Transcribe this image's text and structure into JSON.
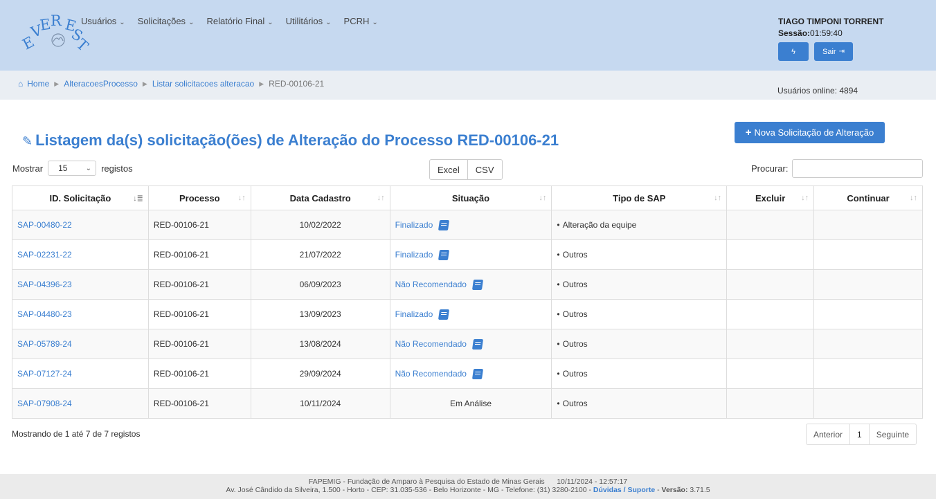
{
  "logo_text": "EVEREST",
  "nav": [
    {
      "label": "Usuários"
    },
    {
      "label": "Solicitações"
    },
    {
      "label": "Relatório Final"
    },
    {
      "label": "Utilitários"
    },
    {
      "label": "PCRH"
    }
  ],
  "user": {
    "name": "TIAGO TIMPONI TORRENT",
    "session_label": "Sessão:",
    "session_time": "01:59:40",
    "bolt_icon": "bolt-icon",
    "logout_label": "Sair",
    "logout_icon": "sign-out-icon"
  },
  "breadcrumb": {
    "home": "Home",
    "items": [
      "AlteracoesProcesso",
      "Listar solicitacoes alteracao"
    ],
    "current": "RED-00106-21"
  },
  "online_users": "Usuários online: 4894",
  "page": {
    "title": "Listagem da(s) solicitação(ões) de Alteração do Processo RED-00106-21",
    "new_button": "Nova Solicitação de Alteração"
  },
  "controls": {
    "show_label": "Mostrar",
    "show_value": "15",
    "show_suffix": "registos",
    "excel": "Excel",
    "csv": "CSV",
    "search_label": "Procurar:",
    "search_value": ""
  },
  "table": {
    "headers": [
      "ID. Solicitação",
      "Processo",
      "Data Cadastro",
      "Situação",
      "Tipo de SAP",
      "Excluir",
      "Continuar"
    ],
    "rows": [
      {
        "id": "SAP-00480-22",
        "processo": "RED-00106-21",
        "data": "10/02/2022",
        "situacao": "Finalizado",
        "tipo": "Alteração da equipe"
      },
      {
        "id": "SAP-02231-22",
        "processo": "RED-00106-21",
        "data": "21/07/2022",
        "situacao": "Finalizado",
        "tipo": "Outros"
      },
      {
        "id": "SAP-04396-23",
        "processo": "RED-00106-21",
        "data": "06/09/2023",
        "situacao": "Não Recomendado",
        "tipo": "Outros"
      },
      {
        "id": "SAP-04480-23",
        "processo": "RED-00106-21",
        "data": "13/09/2023",
        "situacao": "Finalizado",
        "tipo": "Outros"
      },
      {
        "id": "SAP-05789-24",
        "processo": "RED-00106-21",
        "data": "13/08/2024",
        "situacao": "Não Recomendado",
        "tipo": "Outros"
      },
      {
        "id": "SAP-07127-24",
        "processo": "RED-00106-21",
        "data": "29/09/2024",
        "situacao": "Não Recomendado",
        "tipo": "Outros"
      },
      {
        "id": "SAP-07908-24",
        "processo": "RED-00106-21",
        "data": "10/11/2024",
        "situacao": "Em Análise",
        "tipo": "Outros"
      }
    ]
  },
  "info": "Mostrando de 1 até 7 de 7 registos",
  "pager": {
    "prev": "Anterior",
    "current": "1",
    "next": "Seguinte"
  },
  "footer": {
    "line1_org": "FAPEMIG - Fundação de Amparo à Pesquisa do Estado de Minas Gerais",
    "line1_date": "10/11/2024 - 12:57:17",
    "line2_address": "Av. José Cândido da Silveira, 1.500 - Horto - CEP: 31.035-536 - Belo Horizonte - MG - Telefone: (31) 3280-2100 -",
    "support": "Dúvidas / Suporte",
    "version_label": "Versão:",
    "version": "3.71.5"
  },
  "colors": {
    "accent": "#3b7fd0",
    "header_bg": "#c6d9f0",
    "crumb_bg": "#eaeef3"
  }
}
